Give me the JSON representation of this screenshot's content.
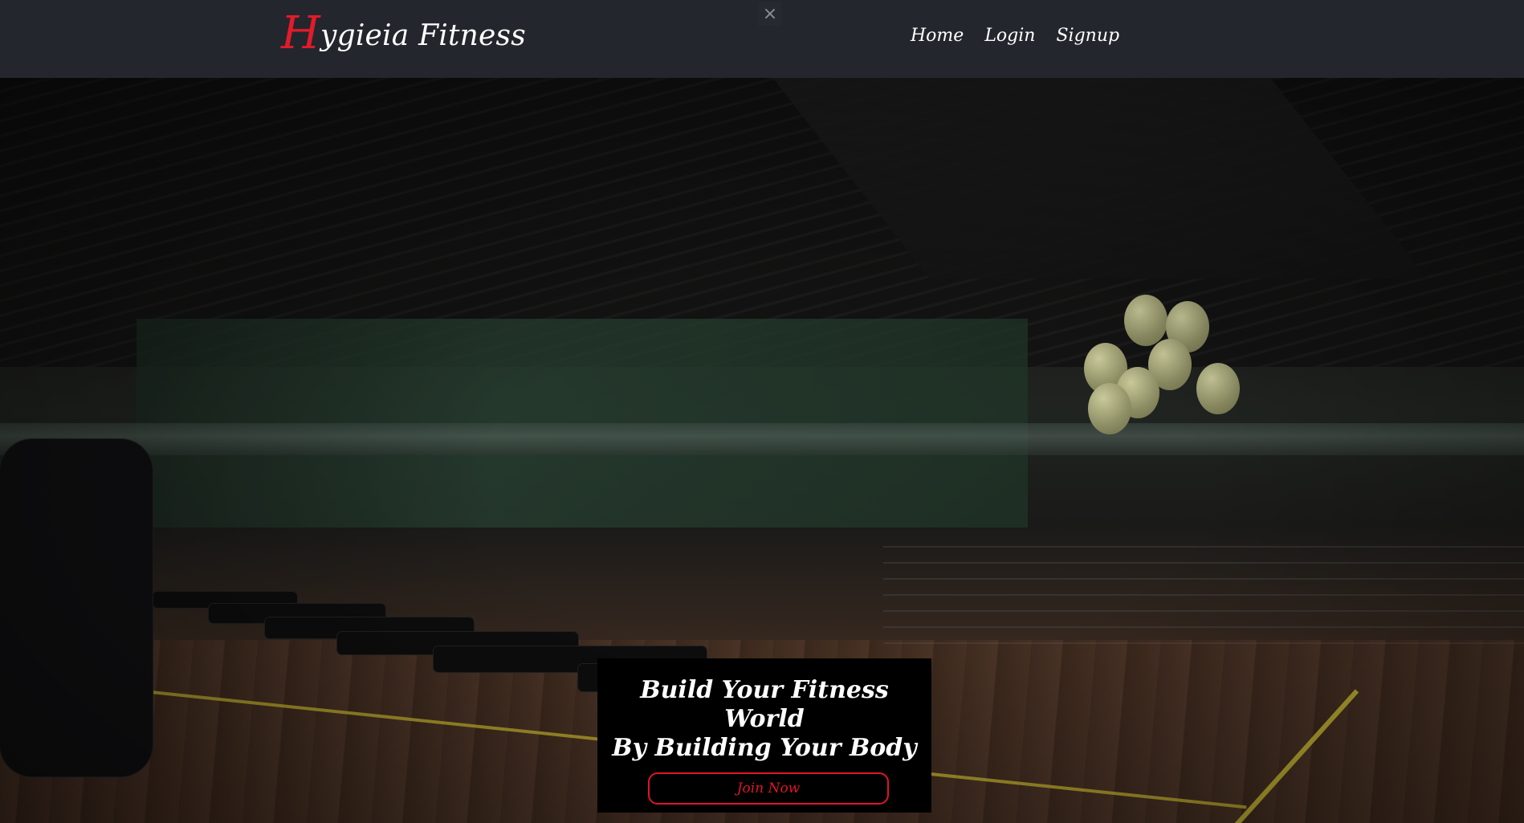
{
  "brand": {
    "initial": "H",
    "rest": "ygieia Fitness"
  },
  "dismiss": {
    "symbol": "×"
  },
  "nav": {
    "items": [
      {
        "label": "Home"
      },
      {
        "label": "Login"
      },
      {
        "label": "Signup"
      }
    ]
  },
  "hero": {
    "heading_line1": "Build Your Fitness World",
    "heading_line2": "By Building Your Body",
    "cta_label": "Join Now"
  },
  "colors": {
    "accent": "#e0142a",
    "navbar": "#23272d",
    "cta_bg": "#000000"
  },
  "icons": {
    "close": "close-icon"
  }
}
